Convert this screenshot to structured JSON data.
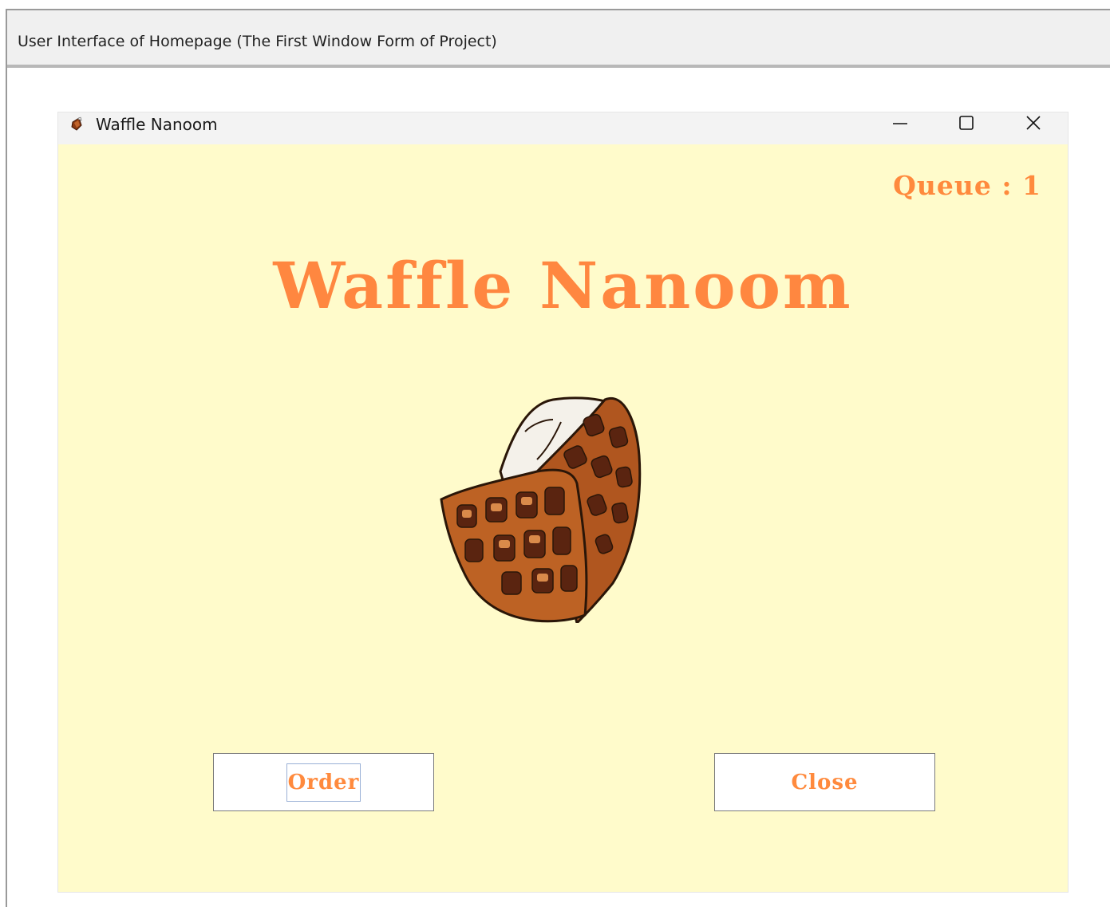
{
  "caption": {
    "text": "User Interface of Homepage (The First Window Form of Project)"
  },
  "window": {
    "title": "Waffle Nanoom",
    "controls": {
      "minimize_icon": "minimize-icon",
      "maximize_icon": "maximize-icon",
      "close_icon": "close-icon"
    }
  },
  "main": {
    "queue_text": "Queue : 1",
    "title": "Waffle Nanoom",
    "image": "waffle-illustration"
  },
  "buttons": {
    "order_label": "Order",
    "close_label": "Close"
  },
  "colors": {
    "background": "#fffbcb",
    "accent": "#ff8a3d",
    "titlebar": "#f3f3f3"
  }
}
